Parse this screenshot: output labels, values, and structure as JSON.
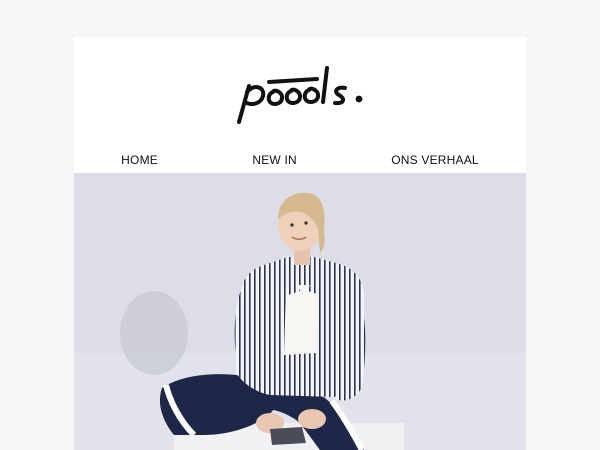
{
  "brand": {
    "logo_text": "pooools."
  },
  "nav": {
    "items": [
      {
        "label": "HOME"
      },
      {
        "label": "NEW IN"
      },
      {
        "label": "ONS VERHAAL"
      }
    ]
  },
  "hero": {
    "image_subject": "model-striped-jacket"
  },
  "colors": {
    "page_bg": "#f6f6f6",
    "card_bg": "#ffffff",
    "hero_bg": "#dcdde5",
    "text": "#111111"
  }
}
